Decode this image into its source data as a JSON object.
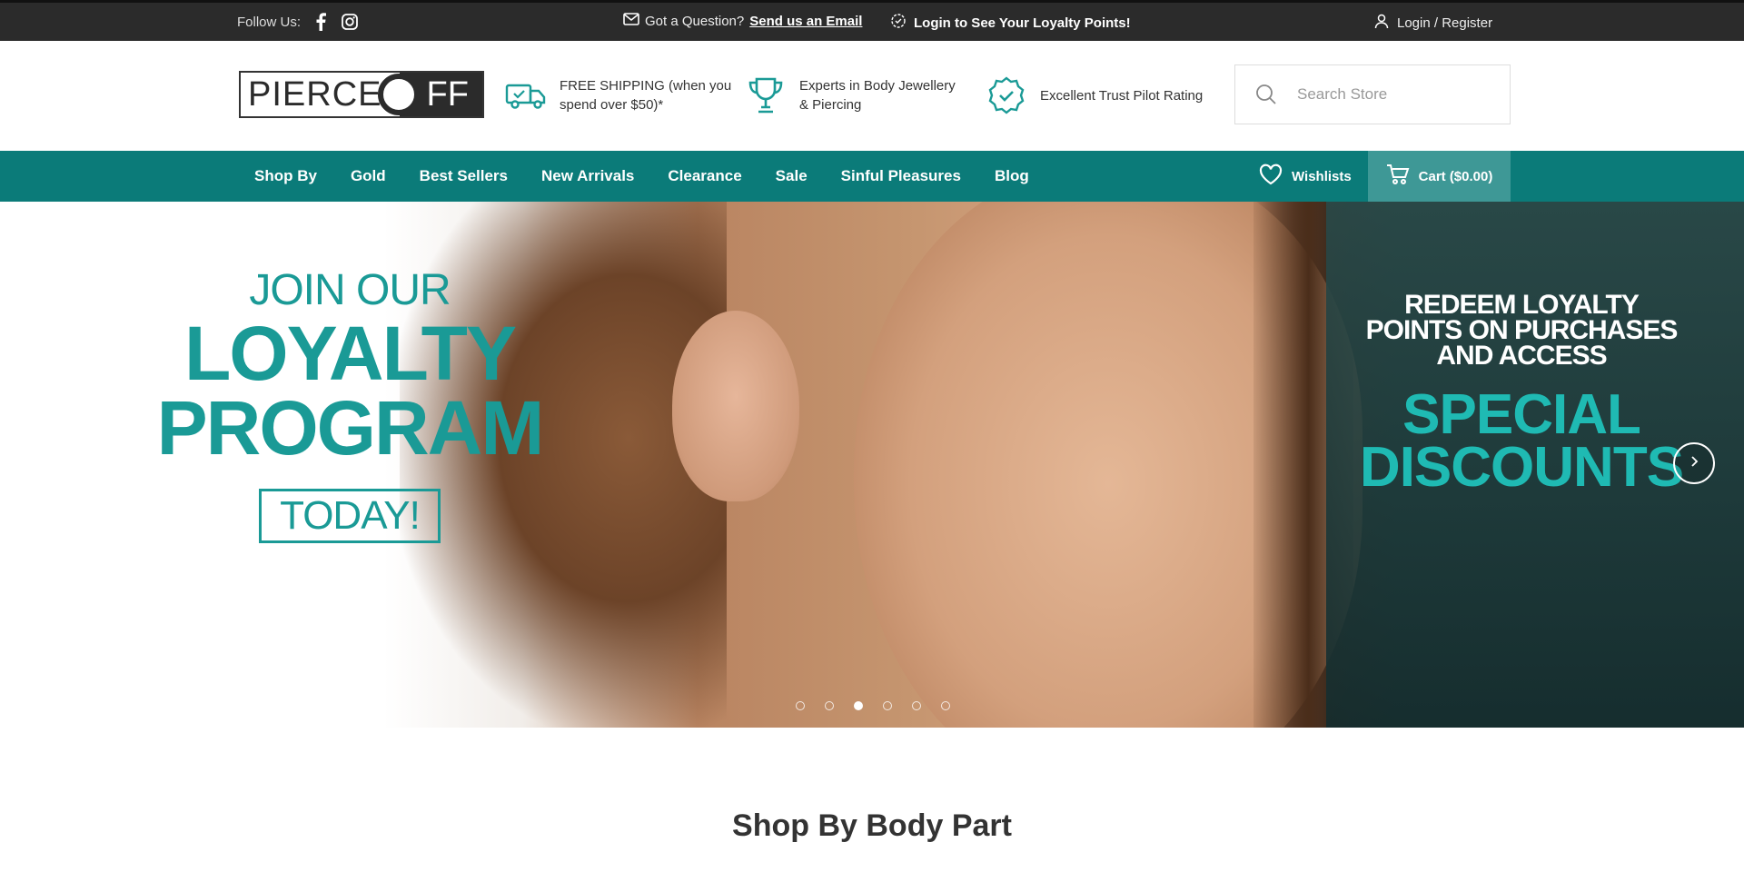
{
  "topbar": {
    "follow_label": "Follow Us:",
    "social": [
      {
        "name": "facebook-icon"
      },
      {
        "name": "instagram-icon"
      }
    ],
    "question_label": "Got a Question?",
    "question_link": "Send us an Email",
    "loyalty_label": "Login to See Your Loyalty Points!",
    "login_label": "Login / Register"
  },
  "header": {
    "logo_left": "PIERCE",
    "logo_right": "FF",
    "features": [
      {
        "icon": "truck-icon",
        "line1": "FREE SHIPPING (when you",
        "line2": "spend over $50)*"
      },
      {
        "icon": "trophy-icon",
        "line1": "Experts in Body Jewellery",
        "line2": "& Piercing"
      },
      {
        "icon": "badge-check-icon",
        "line1": "Excellent Trust Pilot Rating",
        "line2": ""
      }
    ],
    "search_placeholder": "Search Store"
  },
  "nav": {
    "items": [
      "Shop By",
      "Gold",
      "Best Sellers",
      "New Arrivals",
      "Clearance",
      "Sale",
      "Sinful Pleasures",
      "Blog"
    ],
    "wishlists_label": "Wishlists",
    "cart_label": "Cart ($0.00)"
  },
  "hero": {
    "join_line1": "JOIN OUR",
    "join_line2": "LOYALTY",
    "join_line3": "PROGRAM",
    "today": "TODAY!",
    "redeem_line1": "REDEEM LOYALTY",
    "redeem_line2": "POINTS ON PURCHASES",
    "redeem_line3": "AND ACCESS",
    "special_line1": "SPECIAL",
    "special_line2": "DISCOUNTS",
    "slide_count": 6,
    "active_slide": 3
  },
  "colors": {
    "teal": "#0b7b79",
    "teal_light": "#1a9a96",
    "topbar": "#2b2b2b"
  },
  "section": {
    "title": "Shop By Body Part"
  }
}
